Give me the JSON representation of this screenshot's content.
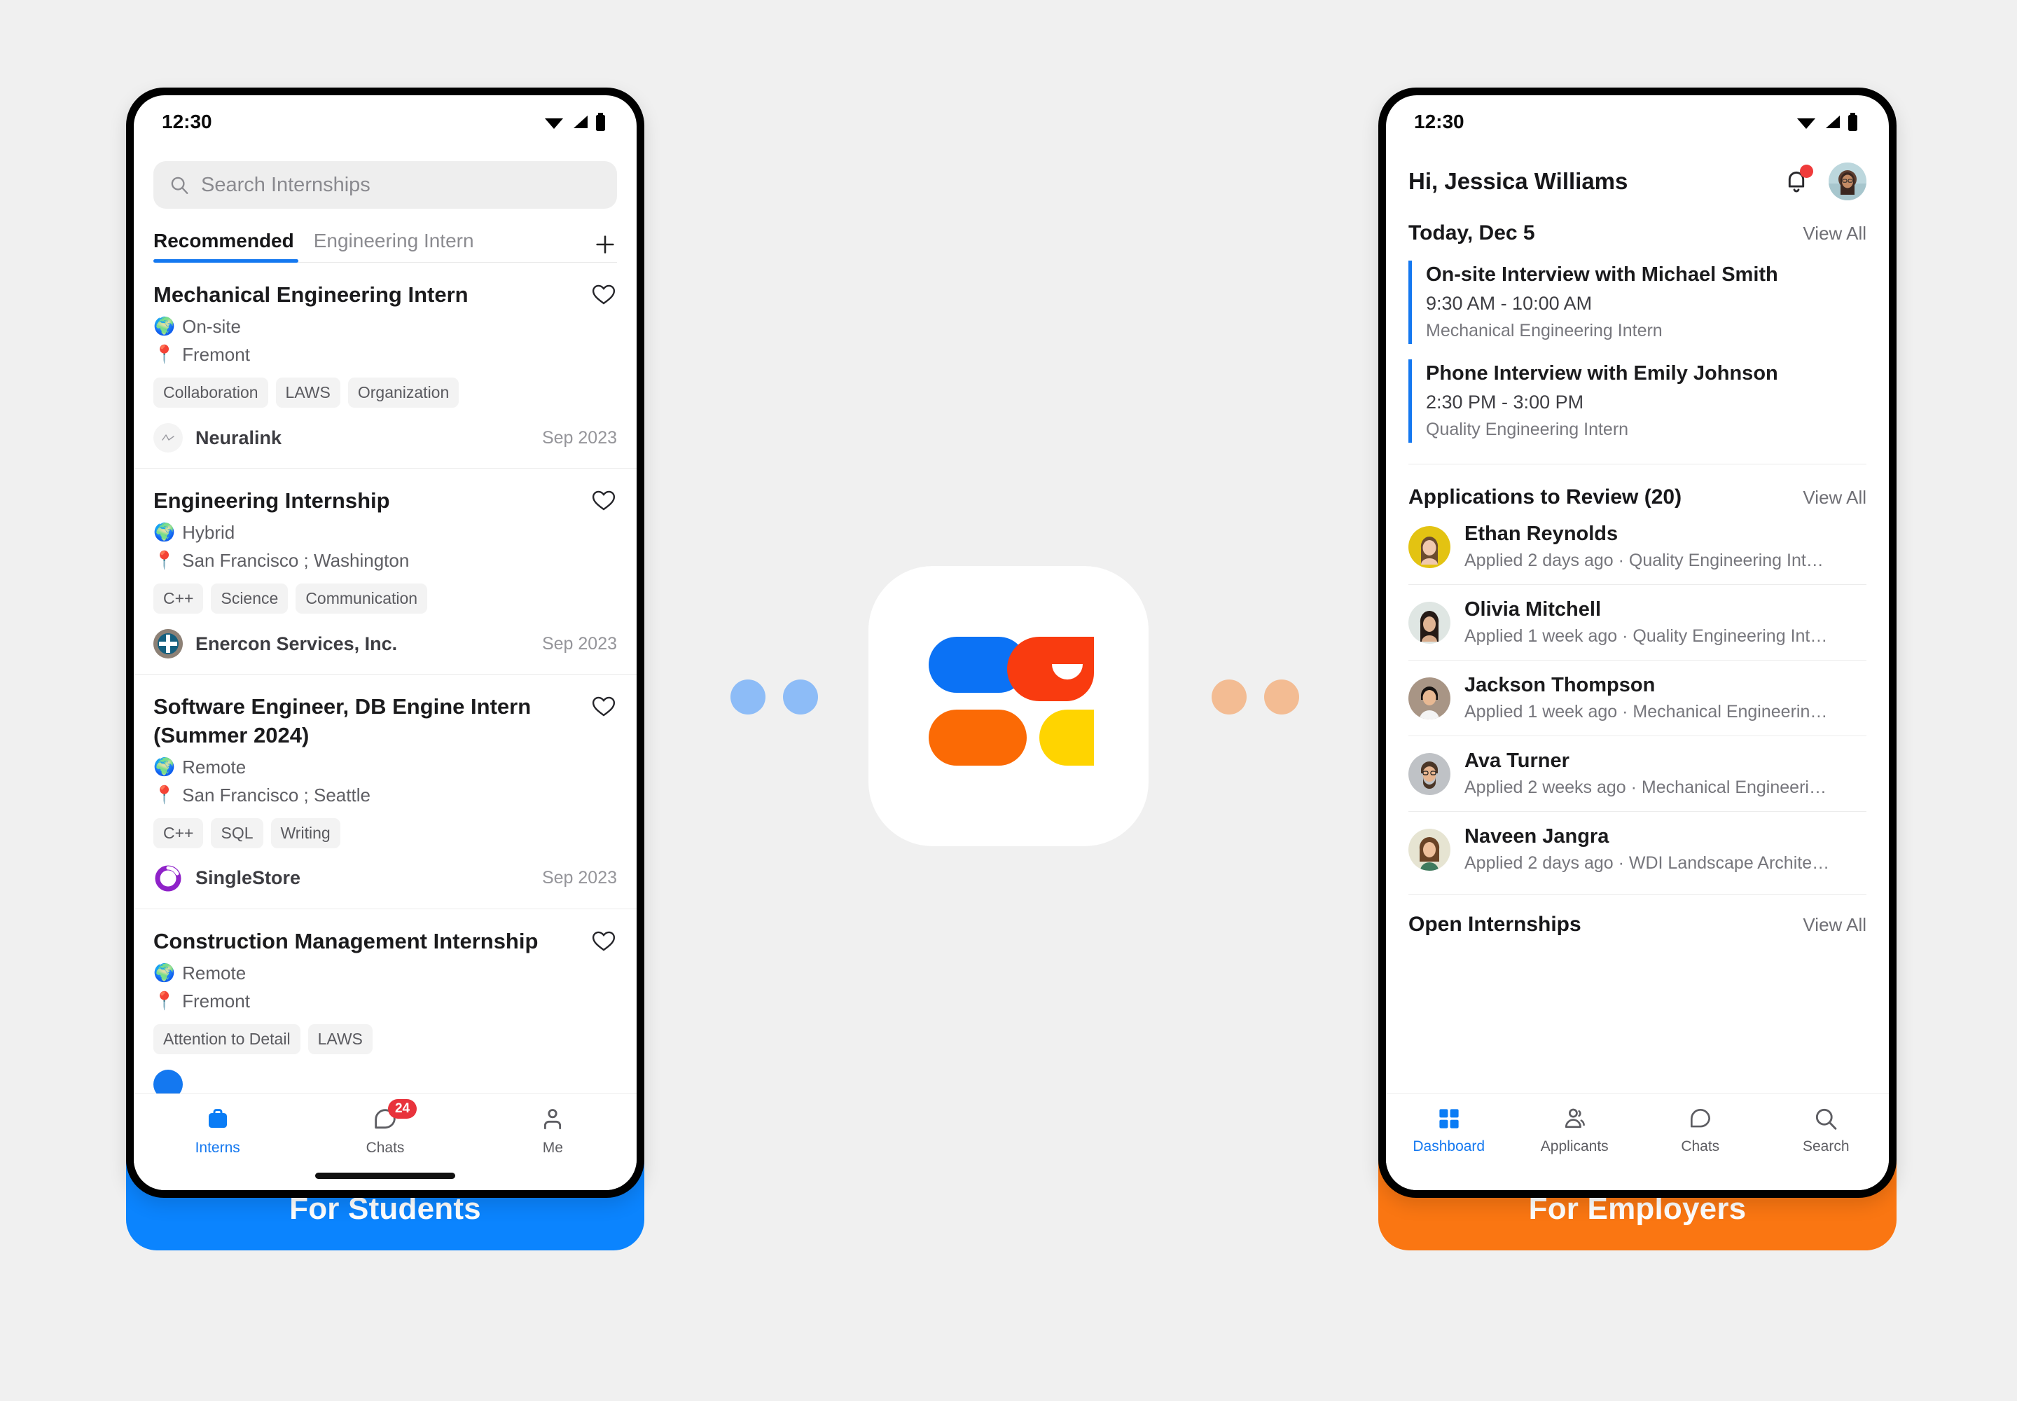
{
  "theme": {
    "page_bg": "#f0f0f0",
    "student_accent": "#0b84fe",
    "employer_accent": "#fa7612",
    "badge_red": "#e8333c",
    "dot_blue": "#8dbcf7",
    "dot_orange": "#f3bc93",
    "logo_blue": "#0b72f5",
    "logo_red": "#f93b0f",
    "logo_orange": "#fb6a05",
    "logo_yellow": "#ffd400"
  },
  "student_phone": {
    "status_bar": {
      "time": "12:30",
      "icons": [
        "wifi-icon",
        "signal-icon",
        "battery-icon"
      ]
    },
    "search": {
      "placeholder": "Search Internships",
      "icon": "search-icon"
    },
    "tabs": [
      {
        "label": "Recommended",
        "active": true
      },
      {
        "label": "Engineering Intern",
        "active": false
      }
    ],
    "add_tab_icon": "plus-icon",
    "jobs": [
      {
        "title": "Mechanical Engineering Intern",
        "work_mode": "On-site",
        "work_mode_icon": "globe-icon",
        "location": "Fremont",
        "location_icon": "pin-icon",
        "chips": [
          "Collaboration",
          "LAWS",
          "Organization"
        ],
        "company": "Neuralink",
        "company_logo": "neuralink-logo",
        "date": "Sep 2023",
        "favorite_icon": "heart-outline-icon"
      },
      {
        "title": "Engineering Internship",
        "work_mode": "Hybrid",
        "work_mode_icon": "globe-icon",
        "location": "San Francisco ; Washington",
        "location_icon": "pin-icon",
        "chips": [
          "C++",
          "Science",
          "Communication"
        ],
        "company": "Enercon Services, Inc.",
        "company_logo": "enercon-logo",
        "date": "Sep 2023",
        "favorite_icon": "heart-outline-icon"
      },
      {
        "title": "Software Engineer, DB Engine Intern (Summer 2024)",
        "work_mode": "Remote",
        "work_mode_icon": "globe-icon",
        "location": "San Francisco ; Seattle",
        "location_icon": "pin-icon",
        "chips": [
          "C++",
          "SQL",
          "Writing"
        ],
        "company": "SingleStore",
        "company_logo": "singlestore-logo",
        "date": "Sep 2023",
        "favorite_icon": "heart-outline-icon"
      },
      {
        "title": "Construction Management Internship",
        "work_mode": "Remote",
        "work_mode_icon": "globe-icon",
        "location": "Fremont",
        "location_icon": "pin-icon",
        "chips": [
          "Attention to Detail",
          "LAWS"
        ],
        "company": "",
        "company_logo": "blue-circle-logo",
        "date": "",
        "favorite_icon": "heart-outline-icon"
      }
    ],
    "tabbar": [
      {
        "label": "Interns",
        "icon": "briefcase-icon",
        "active": true,
        "badge": ""
      },
      {
        "label": "Chats",
        "icon": "chat-bubble-icon",
        "active": false,
        "badge": "24"
      },
      {
        "label": "Me",
        "icon": "person-icon",
        "active": false,
        "badge": ""
      }
    ],
    "banner_label": "For Students"
  },
  "employer_phone": {
    "status_bar": {
      "time": "12:30",
      "icons": [
        "wifi-icon",
        "signal-icon",
        "battery-icon"
      ]
    },
    "greeting": "Hi, Jessica Williams",
    "notification_icon": "bell-icon",
    "has_notification_dot": true,
    "avatar": "user-avatar",
    "schedule": {
      "title": "Today, Dec 5",
      "view_all": "View All",
      "events": [
        {
          "title": "On-site Interview with Michael Smith",
          "time": "9:30 AM - 10:00 AM",
          "role": "Mechanical Engineering Intern"
        },
        {
          "title": "Phone Interview with Emily Johnson",
          "time": "2:30 PM - 3:00 PM",
          "role": "Quality Engineering Intern"
        }
      ]
    },
    "applications": {
      "title": "Applications to Review (20)",
      "view_all": "View All",
      "rows": [
        {
          "name": "Ethan Reynolds",
          "sub": "Applied 2 days ago · Quality Engineering Int…",
          "avatar_bg": "#e3c312"
        },
        {
          "name": "Olivia Mitchell",
          "sub": "Applied 1 week ago · Quality Engineering Int…",
          "avatar_bg": "#d9e2e0"
        },
        {
          "name": "Jackson Thompson",
          "sub": "Applied 1 week ago · Mechanical Engineerin…",
          "avatar_bg": "#b4a596"
        },
        {
          "name": "Ava Turner",
          "sub": "Applied 2 weeks ago · Mechanical Engineeri…",
          "avatar_bg": "#bfc2c6"
        },
        {
          "name": "Naveen Jangra",
          "sub": "Applied 2 days ago · WDI Landscape Archite…",
          "avatar_bg": "#dfe0cf"
        }
      ]
    },
    "open_internships": {
      "title": "Open Internships",
      "view_all": "View All"
    },
    "tabbar": [
      {
        "label": "Dashboard",
        "icon": "grid-icon",
        "active": true
      },
      {
        "label": "Applicants",
        "icon": "people-icon",
        "active": false
      },
      {
        "label": "Chats",
        "icon": "chat-bubble-icon",
        "active": false
      },
      {
        "label": "Search",
        "icon": "search-icon",
        "active": false
      }
    ],
    "banner_label": "For Employers"
  },
  "center": {
    "app_logo": "app-logo-tile",
    "left_dots": [
      "dot",
      "dot"
    ],
    "right_dots": [
      "dot",
      "dot"
    ]
  }
}
